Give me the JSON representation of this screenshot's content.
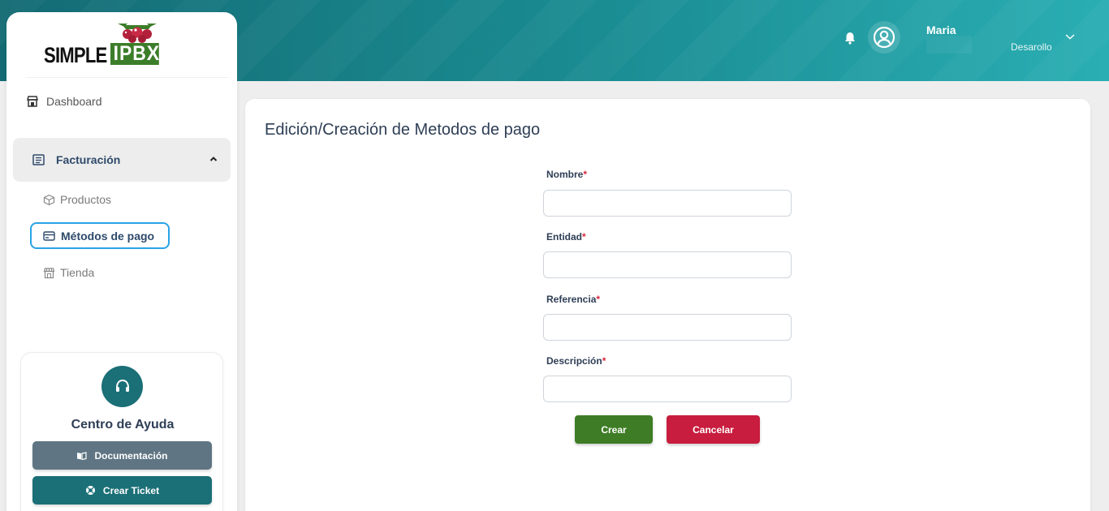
{
  "header": {
    "user_name": "Maria",
    "user_role": "Desarollo"
  },
  "logo": {
    "text_left": "SIMPLE",
    "text_right": "IPBX"
  },
  "sidebar": {
    "items": [
      {
        "label": "Dashboard",
        "icon": "store-icon"
      },
      {
        "label": "Facturación",
        "icon": "book-icon",
        "expanded": true
      },
      {
        "label": "Productos",
        "icon": "box-icon"
      },
      {
        "label": "Métodos de pago",
        "icon": "credit-card-icon",
        "active": true
      },
      {
        "label": "Tienda",
        "icon": "shop-icon"
      }
    ]
  },
  "help": {
    "title": "Centro de Ayuda",
    "doc_label": "Documentación",
    "ticket_label": "Crear Ticket"
  },
  "form": {
    "title": "Edición/Creación de Metodos de pago",
    "fields": [
      {
        "label": "Nombre",
        "required_mark": "*",
        "value": ""
      },
      {
        "label": "Entidad",
        "required_mark": "*",
        "value": ""
      },
      {
        "label": "Referencia",
        "required_mark": "*",
        "value": ""
      },
      {
        "label": "Descripción",
        "required_mark": "*",
        "value": ""
      }
    ],
    "submit_label": "Crear",
    "cancel_label": "Cancelar"
  },
  "colors": {
    "header_teal": "#1a8d93",
    "accent_green": "#3e7d25",
    "danger_red": "#c81d3e",
    "active_border": "#2aa3e6"
  }
}
